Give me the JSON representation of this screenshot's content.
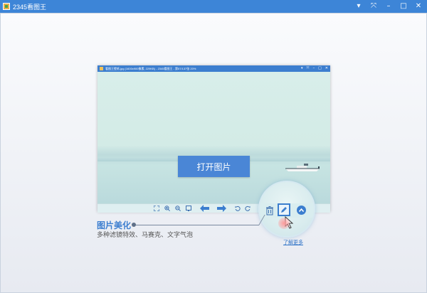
{
  "window": {
    "title": "2345看图王",
    "controls": {
      "menu": "▾",
      "fullscreen": "⤧",
      "minimize": "–",
      "maximize": "□",
      "close": "✕"
    }
  },
  "preview": {
    "title": "看图王壁纸.jpg (1600x900像素, 229KB) - 2345看图王 - 第57/137张 20%",
    "controls": {
      "menu": "▾",
      "fullscreen": "⤧",
      "minimize": "–",
      "maximize": "□",
      "close": "✕"
    },
    "open_button": "打开图片"
  },
  "feature": {
    "title": "图片美化",
    "description": "多种滤镜特效、马赛克、文字气泡",
    "link": "了解更多"
  },
  "colors": {
    "accent": "#3d85d7",
    "button": "#4a86d6",
    "title_text": "#3e7fd0"
  },
  "icons": [
    "fit-icon",
    "zoom-in-icon",
    "zoom-out-icon",
    "actual-size-icon",
    "prev-arrow-icon",
    "next-arrow-icon",
    "rotate-left-icon",
    "rotate-right-icon",
    "delete-icon",
    "edit-icon",
    "more-up-icon"
  ]
}
